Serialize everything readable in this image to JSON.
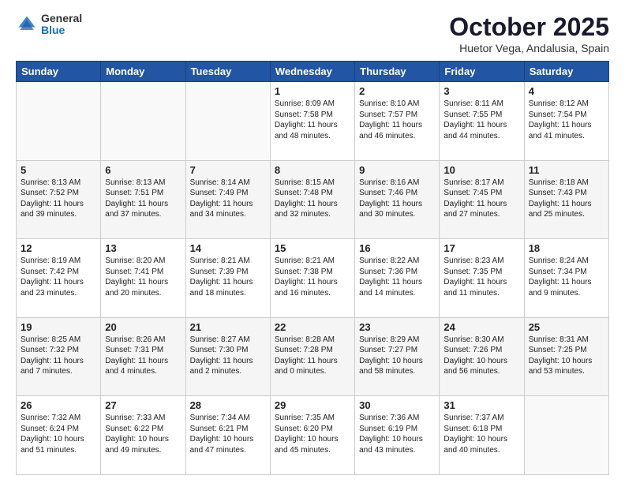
{
  "header": {
    "logo_general": "General",
    "logo_blue": "Blue",
    "month_title": "October 2025",
    "location": "Huetor Vega, Andalusia, Spain"
  },
  "weekdays": [
    "Sunday",
    "Monday",
    "Tuesday",
    "Wednesday",
    "Thursday",
    "Friday",
    "Saturday"
  ],
  "weeks": [
    [
      {
        "day": "",
        "info": ""
      },
      {
        "day": "",
        "info": ""
      },
      {
        "day": "",
        "info": ""
      },
      {
        "day": "1",
        "info": "Sunrise: 8:09 AM\nSunset: 7:58 PM\nDaylight: 11 hours\nand 48 minutes."
      },
      {
        "day": "2",
        "info": "Sunrise: 8:10 AM\nSunset: 7:57 PM\nDaylight: 11 hours\nand 46 minutes."
      },
      {
        "day": "3",
        "info": "Sunrise: 8:11 AM\nSunset: 7:55 PM\nDaylight: 11 hours\nand 44 minutes."
      },
      {
        "day": "4",
        "info": "Sunrise: 8:12 AM\nSunset: 7:54 PM\nDaylight: 11 hours\nand 41 minutes."
      }
    ],
    [
      {
        "day": "5",
        "info": "Sunrise: 8:13 AM\nSunset: 7:52 PM\nDaylight: 11 hours\nand 39 minutes."
      },
      {
        "day": "6",
        "info": "Sunrise: 8:13 AM\nSunset: 7:51 PM\nDaylight: 11 hours\nand 37 minutes."
      },
      {
        "day": "7",
        "info": "Sunrise: 8:14 AM\nSunset: 7:49 PM\nDaylight: 11 hours\nand 34 minutes."
      },
      {
        "day": "8",
        "info": "Sunrise: 8:15 AM\nSunset: 7:48 PM\nDaylight: 11 hours\nand 32 minutes."
      },
      {
        "day": "9",
        "info": "Sunrise: 8:16 AM\nSunset: 7:46 PM\nDaylight: 11 hours\nand 30 minutes."
      },
      {
        "day": "10",
        "info": "Sunrise: 8:17 AM\nSunset: 7:45 PM\nDaylight: 11 hours\nand 27 minutes."
      },
      {
        "day": "11",
        "info": "Sunrise: 8:18 AM\nSunset: 7:43 PM\nDaylight: 11 hours\nand 25 minutes."
      }
    ],
    [
      {
        "day": "12",
        "info": "Sunrise: 8:19 AM\nSunset: 7:42 PM\nDaylight: 11 hours\nand 23 minutes."
      },
      {
        "day": "13",
        "info": "Sunrise: 8:20 AM\nSunset: 7:41 PM\nDaylight: 11 hours\nand 20 minutes."
      },
      {
        "day": "14",
        "info": "Sunrise: 8:21 AM\nSunset: 7:39 PM\nDaylight: 11 hours\nand 18 minutes."
      },
      {
        "day": "15",
        "info": "Sunrise: 8:21 AM\nSunset: 7:38 PM\nDaylight: 11 hours\nand 16 minutes."
      },
      {
        "day": "16",
        "info": "Sunrise: 8:22 AM\nSunset: 7:36 PM\nDaylight: 11 hours\nand 14 minutes."
      },
      {
        "day": "17",
        "info": "Sunrise: 8:23 AM\nSunset: 7:35 PM\nDaylight: 11 hours\nand 11 minutes."
      },
      {
        "day": "18",
        "info": "Sunrise: 8:24 AM\nSunset: 7:34 PM\nDaylight: 11 hours\nand 9 minutes."
      }
    ],
    [
      {
        "day": "19",
        "info": "Sunrise: 8:25 AM\nSunset: 7:32 PM\nDaylight: 11 hours\nand 7 minutes."
      },
      {
        "day": "20",
        "info": "Sunrise: 8:26 AM\nSunset: 7:31 PM\nDaylight: 11 hours\nand 4 minutes."
      },
      {
        "day": "21",
        "info": "Sunrise: 8:27 AM\nSunset: 7:30 PM\nDaylight: 11 hours\nand 2 minutes."
      },
      {
        "day": "22",
        "info": "Sunrise: 8:28 AM\nSunset: 7:28 PM\nDaylight: 11 hours\nand 0 minutes."
      },
      {
        "day": "23",
        "info": "Sunrise: 8:29 AM\nSunset: 7:27 PM\nDaylight: 10 hours\nand 58 minutes."
      },
      {
        "day": "24",
        "info": "Sunrise: 8:30 AM\nSunset: 7:26 PM\nDaylight: 10 hours\nand 56 minutes."
      },
      {
        "day": "25",
        "info": "Sunrise: 8:31 AM\nSunset: 7:25 PM\nDaylight: 10 hours\nand 53 minutes."
      }
    ],
    [
      {
        "day": "26",
        "info": "Sunrise: 7:32 AM\nSunset: 6:24 PM\nDaylight: 10 hours\nand 51 minutes."
      },
      {
        "day": "27",
        "info": "Sunrise: 7:33 AM\nSunset: 6:22 PM\nDaylight: 10 hours\nand 49 minutes."
      },
      {
        "day": "28",
        "info": "Sunrise: 7:34 AM\nSunset: 6:21 PM\nDaylight: 10 hours\nand 47 minutes."
      },
      {
        "day": "29",
        "info": "Sunrise: 7:35 AM\nSunset: 6:20 PM\nDaylight: 10 hours\nand 45 minutes."
      },
      {
        "day": "30",
        "info": "Sunrise: 7:36 AM\nSunset: 6:19 PM\nDaylight: 10 hours\nand 43 minutes."
      },
      {
        "day": "31",
        "info": "Sunrise: 7:37 AM\nSunset: 6:18 PM\nDaylight: 10 hours\nand 40 minutes."
      },
      {
        "day": "",
        "info": ""
      }
    ]
  ]
}
